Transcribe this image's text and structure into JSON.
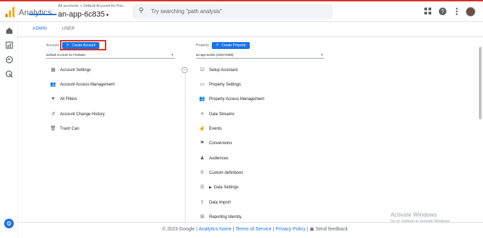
{
  "header": {
    "app_name": "Analytics",
    "breadcrumb_all": "All accounts",
    "breadcrumb_sep": ">",
    "breadcrumb_account": "Default Account for Fire...",
    "property_title": "an-app-6c835",
    "search_placeholder": "Try searching \"path analysis\""
  },
  "tabs": [
    {
      "label": "ADMIN",
      "active": true
    },
    {
      "label": "USER",
      "active": false
    }
  ],
  "account": {
    "label": "Account",
    "create_label": "Create Account",
    "selected": "Default Account for Firebase",
    "items": [
      {
        "label": "Account Settings",
        "icon": "building-icon"
      },
      {
        "label": "Account Access Management",
        "icon": "people-icon"
      },
      {
        "label": "All Filters",
        "icon": "filter-icon"
      },
      {
        "label": "Account Change History",
        "icon": "history-icon"
      },
      {
        "label": "Trash Can",
        "icon": "trash-icon"
      }
    ]
  },
  "property": {
    "label": "Property",
    "create_label": "Create Property",
    "selected": "an-app-6c835 (230279488)",
    "items": [
      {
        "label": "Setup Assistant",
        "icon": "checkbox-icon"
      },
      {
        "label": "Property Settings",
        "icon": "settings-page-icon"
      },
      {
        "label": "Property Access Management",
        "icon": "people-icon"
      },
      {
        "label": "Data Streams",
        "icon": "streams-icon"
      },
      {
        "label": "Events",
        "icon": "touch-icon"
      },
      {
        "label": "Conversions",
        "icon": "flag-icon"
      },
      {
        "label": "Audiences",
        "icon": "audience-icon"
      },
      {
        "label": "Custom definitions",
        "icon": "custom-icon"
      },
      {
        "label": "Data Settings",
        "icon": "database-icon"
      },
      {
        "label": "Data Import",
        "icon": "upload-icon"
      },
      {
        "label": "Reporting Identity",
        "icon": "identity-icon"
      }
    ]
  },
  "footer": {
    "copyright": "© 2023 Google",
    "analytics_home": "Analytics home",
    "terms": "Terms of Service",
    "privacy": "Privacy Policy",
    "feedback": "Send feedback"
  },
  "watermark": {
    "title": "Activate Windows",
    "subtitle": "Go to Settings to activate Windows."
  },
  "colors": {
    "accent": "#1a73e8",
    "highlight": "#d93025",
    "logo_orange": "#f9ab00",
    "logo_dark": "#e37400"
  }
}
